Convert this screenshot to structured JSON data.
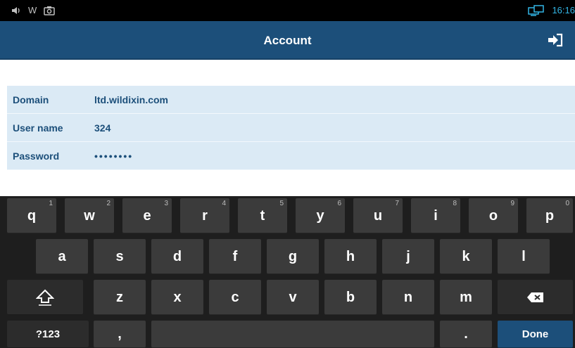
{
  "status_bar": {
    "left_icons": [
      "volume-icon",
      "w-icon",
      "camera-icon"
    ],
    "w_glyph": "W",
    "time": "16:16"
  },
  "header": {
    "title": "Account",
    "logout_icon": "logout-icon"
  },
  "form": {
    "fields": [
      {
        "label": "Domain",
        "value": "ltd.wildixin.com"
      },
      {
        "label": "User name",
        "value": "324"
      },
      {
        "label": "Password",
        "value": "••••••••"
      }
    ]
  },
  "keyboard": {
    "row1": [
      {
        "key": "q",
        "hint": "1"
      },
      {
        "key": "w",
        "hint": "2"
      },
      {
        "key": "e",
        "hint": "3"
      },
      {
        "key": "r",
        "hint": "4"
      },
      {
        "key": "t",
        "hint": "5"
      },
      {
        "key": "y",
        "hint": "6"
      },
      {
        "key": "u",
        "hint": "7"
      },
      {
        "key": "i",
        "hint": "8"
      },
      {
        "key": "o",
        "hint": "9"
      },
      {
        "key": "p",
        "hint": "0"
      }
    ],
    "row2": [
      "a",
      "s",
      "d",
      "f",
      "g",
      "h",
      "j",
      "k",
      "l"
    ],
    "row3": [
      "z",
      "x",
      "c",
      "v",
      "b",
      "n",
      "m"
    ],
    "symbols_label": "?123",
    "comma": ",",
    "period": ".",
    "done_label": "Done",
    "accent_color": "#1c4f7a"
  }
}
